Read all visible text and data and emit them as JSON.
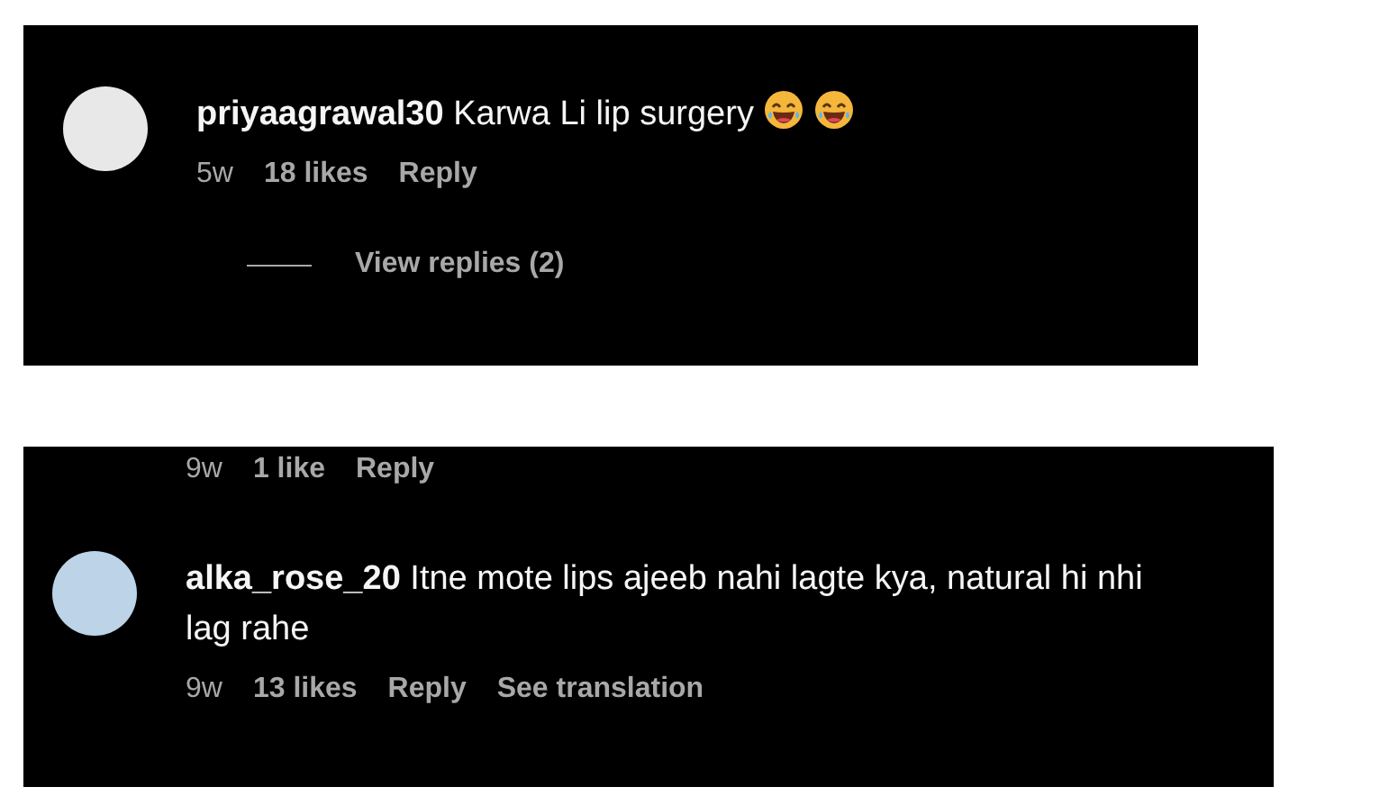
{
  "panels": [
    {
      "items": [
        {
          "kind": "comment",
          "username": "priyaagrawal30",
          "text": "Karwa Li lip surgery",
          "trailing_emoji": true,
          "time": "5w",
          "likes": "18 likes",
          "reply": "Reply"
        },
        {
          "kind": "replies",
          "label": "View replies (2)"
        }
      ]
    },
    {
      "items": [
        {
          "kind": "meta",
          "time": "9w",
          "likes": "1 like",
          "reply": "Reply"
        },
        {
          "kind": "comment",
          "username": "alka_rose_20",
          "text": "Itne mote lips ajeeb nahi lagte kya, natural hi nhi lag rahe",
          "trailing_emoji": false,
          "time": "9w",
          "likes": "13 likes",
          "reply": "Reply",
          "translate": "See translation"
        }
      ]
    }
  ]
}
